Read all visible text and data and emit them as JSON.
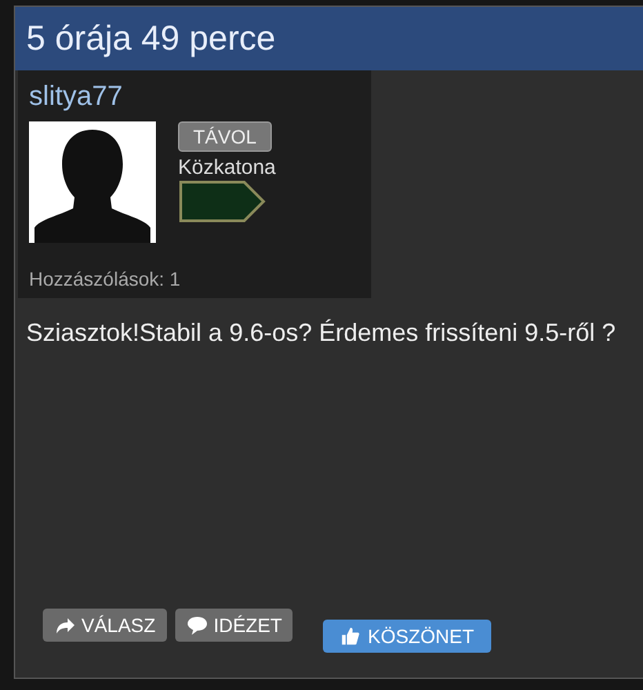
{
  "post": {
    "time": "5 órája 49 perce",
    "author": {
      "name": "slitya77",
      "status": "TÁVOL",
      "rank": "Közkatona",
      "posts": "Hozzászólások: 1"
    },
    "text": "Sziasztok!Stabil a 9.6-os? Érdemes frissíteni 9.5-ről ?",
    "buttons": [
      {
        "kind": "reply",
        "label": "VÁLASZ"
      },
      {
        "kind": "quote",
        "label": "IDÉZET"
      },
      {
        "kind": "thanks",
        "label": "KÖSZÖNET"
      }
    ]
  }
}
